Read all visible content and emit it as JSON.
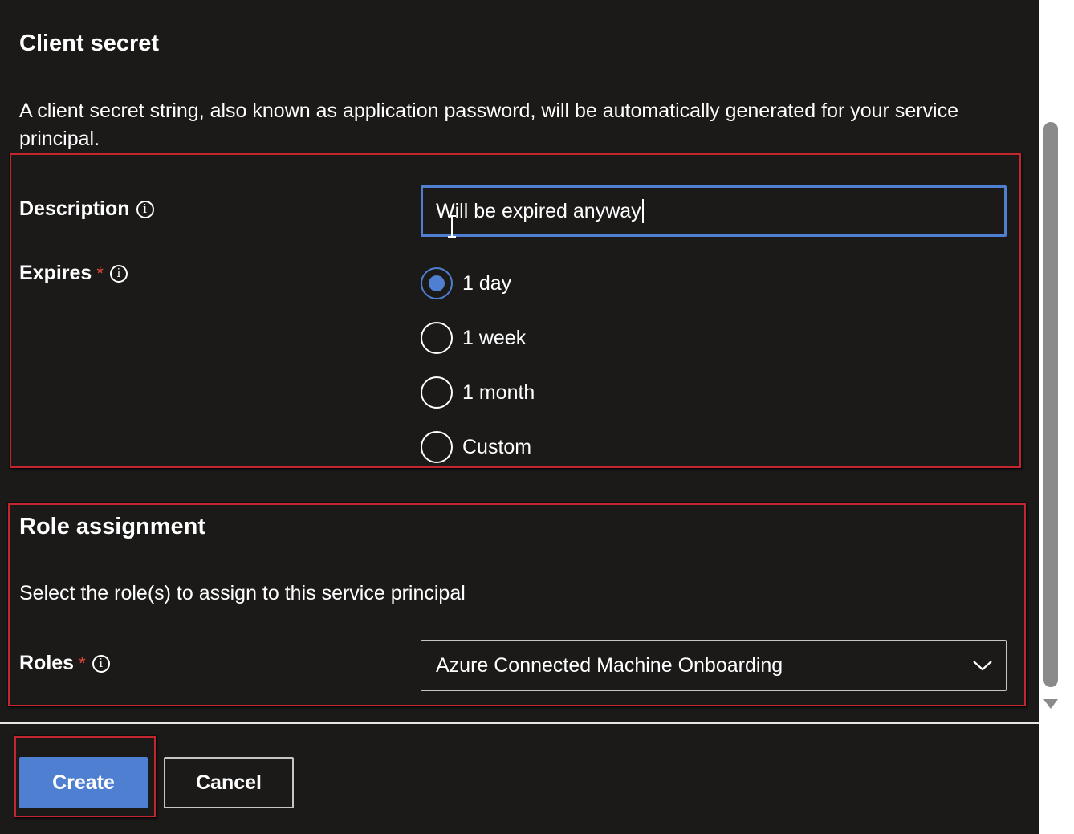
{
  "client_secret": {
    "title": "Client secret",
    "description": "A client secret string, also known as application password, will be automatically generated for your service principal.",
    "fields": {
      "description_label": "Description",
      "description_value": "Will be expired anyway",
      "expires_label": "Expires",
      "required_marker": "*",
      "expires_options": [
        "1 day",
        "1 week",
        "1 month",
        "Custom"
      ],
      "expires_selected": "1 day"
    }
  },
  "role_assignment": {
    "title": "Role assignment",
    "description": "Select the role(s) to assign to this service principal",
    "roles_label": "Roles",
    "required_marker": "*",
    "roles_value": "Azure Connected Machine Onboarding"
  },
  "footer": {
    "create_label": "Create",
    "cancel_label": "Cancel"
  },
  "colors": {
    "accent": "#4f7fd1",
    "highlight_box": "#c4262e",
    "background": "#1b1a19",
    "required": "#e0483d"
  },
  "icons": {
    "info": "info-icon",
    "dropdown": "chevron-down-icon",
    "radio": "radio-icon"
  }
}
